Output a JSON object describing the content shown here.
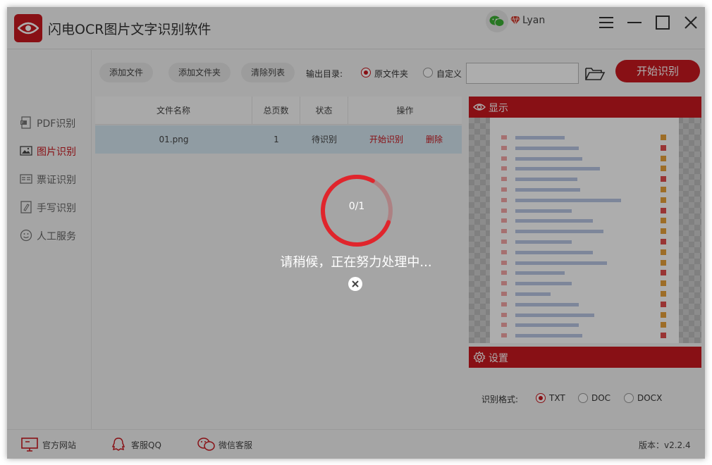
{
  "window": {
    "title": "闪电OCR图片文字识别软件",
    "user_name": "Lyan"
  },
  "sidebar": {
    "items": [
      {
        "label": "PDF识别",
        "icon": "pdf-icon",
        "active": false
      },
      {
        "label": "图片识别",
        "icon": "image-icon",
        "active": true
      },
      {
        "label": "票证识别",
        "icon": "id-card-icon",
        "active": false
      },
      {
        "label": "手写识别",
        "icon": "handwriting-icon",
        "active": false
      },
      {
        "label": "人工服务",
        "icon": "smiley-icon",
        "active": false
      }
    ]
  },
  "toolbar": {
    "add_file": "添加文件",
    "add_folder": "添加文件夹",
    "clear_list": "清除列表",
    "output_label": "输出目录:",
    "output_original": "原文件夹",
    "output_custom": "自定义",
    "output_selected": "原文件夹",
    "path_value": "",
    "start": "开始识别"
  },
  "table": {
    "columns": [
      "文件名称",
      "总页数",
      "状态",
      "操作"
    ],
    "rows": [
      {
        "name": "01.png",
        "pages": "1",
        "status": "待识别",
        "action_start": "开始识别",
        "action_delete": "删除"
      }
    ]
  },
  "preview": {
    "title": "显示"
  },
  "settings": {
    "title": "设置",
    "format_label": "识别格式:",
    "formats": [
      "TXT",
      "DOC",
      "DOCX"
    ],
    "selected_format": "TXT"
  },
  "bottom": {
    "website": "官方网站",
    "qq": "客服QQ",
    "wechat": "微信客服",
    "version": "版本：v2.2.4"
  },
  "modal": {
    "progress": "0/1",
    "message": "请稍候，正在努力处理中..."
  },
  "colors": {
    "accent": "#c9191f",
    "selected_row": "#d4e6f1"
  }
}
